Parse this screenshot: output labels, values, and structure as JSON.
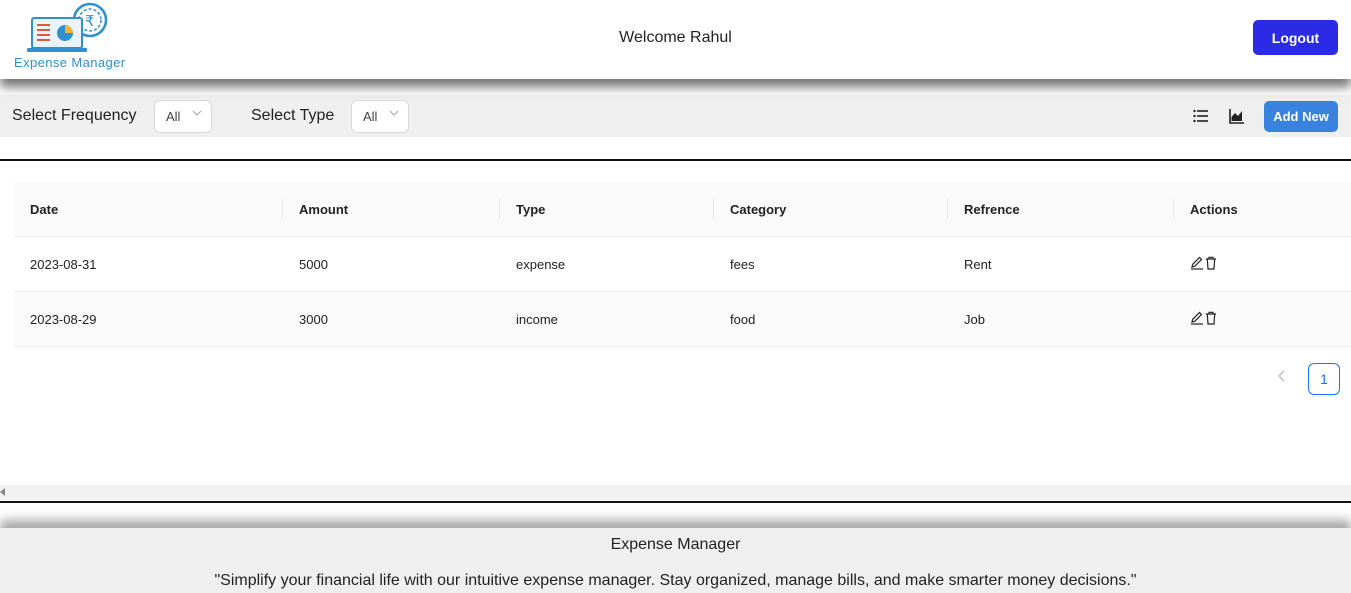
{
  "header": {
    "logo_text": "Expense Manager",
    "welcome": "Welcome Rahul",
    "logout_label": "Logout"
  },
  "filters": {
    "frequency_label": "Select Frequency",
    "frequency_value": "All",
    "type_label": "Select Type",
    "type_value": "All",
    "add_new_label": "Add New"
  },
  "table": {
    "columns": [
      "Date",
      "Amount",
      "Type",
      "Category",
      "Refrence",
      "Actions"
    ],
    "rows": [
      {
        "date": "2023-08-31",
        "amount": "5000",
        "type": "expense",
        "category": "fees",
        "reference": "Rent"
      },
      {
        "date": "2023-08-29",
        "amount": "3000",
        "type": "income",
        "category": "food",
        "reference": "Job"
      }
    ]
  },
  "pagination": {
    "current_page": "1"
  },
  "footer": {
    "title": "Expense Manager",
    "tagline": "\"Simplify your financial life with our intuitive expense manager. Stay organized, manage bills, and make smarter money decisions.\""
  },
  "colors": {
    "logout": "#2b2be6",
    "add_new": "#3a82df",
    "pager_accent": "#1677ff"
  }
}
